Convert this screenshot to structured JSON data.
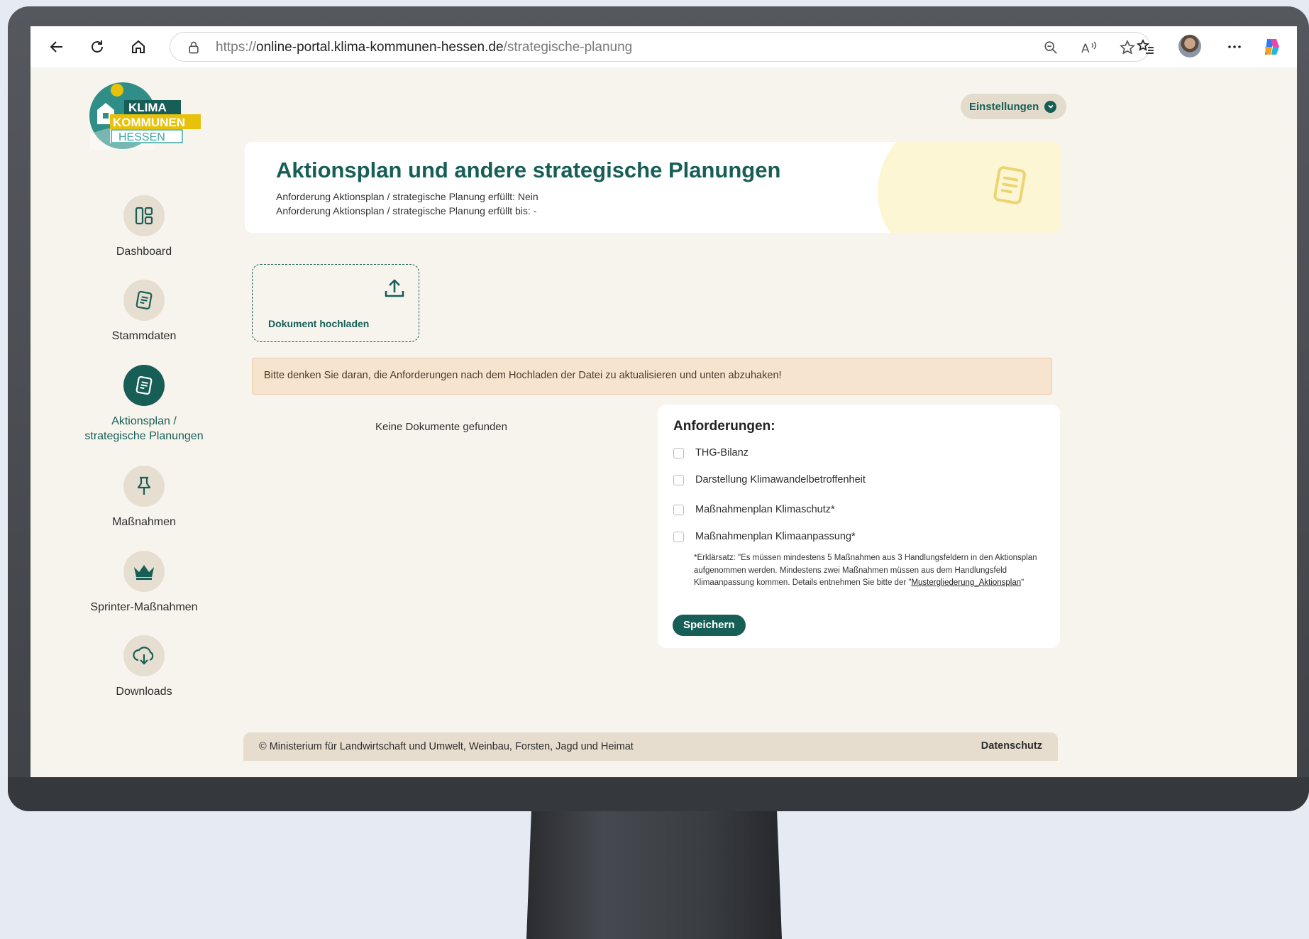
{
  "browser": {
    "url_scheme": "https://",
    "url_host": "online-portal.klima-kommunen-hessen.de",
    "url_path": "/strategische-planung"
  },
  "logo": {
    "line1": "KLIMA",
    "line2": "KOMMUNEN",
    "line3": "HESSEN"
  },
  "sidebar": {
    "items": [
      {
        "label": "Dashboard",
        "icon": "dashboard-icon",
        "active": false
      },
      {
        "label": "Stammdaten",
        "icon": "document-icon",
        "active": false
      },
      {
        "label": "Aktionsplan /",
        "label2": "strategische Planungen",
        "icon": "document-icon",
        "active": true
      },
      {
        "label": "Maßnahmen",
        "icon": "pin-icon",
        "active": false
      },
      {
        "label": "Sprinter-Maßnahmen",
        "icon": "crown-icon",
        "active": false
      },
      {
        "label": "Downloads",
        "icon": "cloud-download-icon",
        "active": false
      }
    ]
  },
  "header": {
    "settings_label": "Einstellungen"
  },
  "hero": {
    "title": "Aktionsplan und andere strategische Planungen",
    "line1": "Anforderung Aktionsplan / strategische Planung erfüllt: Nein",
    "line2": "Anforderung Aktionsplan / strategische Planung erfüllt bis: -"
  },
  "upload": {
    "label": "Dokument hochladen"
  },
  "alert": {
    "text": "Bitte denken Sie daran, die Anforderungen nach dem Hochladen der Datei zu aktualisieren und unten abzuhaken!"
  },
  "documents": {
    "empty_text": "Keine Dokumente gefunden"
  },
  "requirements": {
    "title": "Anforderungen:",
    "items": [
      {
        "label": "THG-Bilanz",
        "checked": false
      },
      {
        "label": "Darstellung Klimawandelbetroffenheit",
        "checked": false
      },
      {
        "label": "Maßnahmenplan Klimaschutz*",
        "checked": false
      },
      {
        "label": "Maßnahmenplan Klimaanpassung*",
        "checked": false
      }
    ],
    "note_text": "*Erklärsatz: \"Es müssen mindestens 5 Maßnahmen aus 3 Handlungsfeldern in den Aktionsplan aufgenommen werden. Mindestens zwei Maßnahmen müssen aus dem Handlungsfeld Klimaanpassung kommen. Details entnehmen Sie bitte der \"",
    "note_link": "Mustergliederung_Aktionsplan",
    "note_end": "\"",
    "save_label": "Speichern"
  },
  "footer": {
    "copyright": "© Ministerium für Landwirtschaft und Umwelt, Weinbau, Forsten, Jagd und Heimat",
    "privacy_link": "Datenschutz"
  },
  "colors": {
    "primary": "#175e57",
    "background": "#f7f4ee",
    "alert_bg": "#f7e4cf",
    "logo_yellow": "#e8c20a",
    "logo_teal": "#3aa8a3"
  }
}
